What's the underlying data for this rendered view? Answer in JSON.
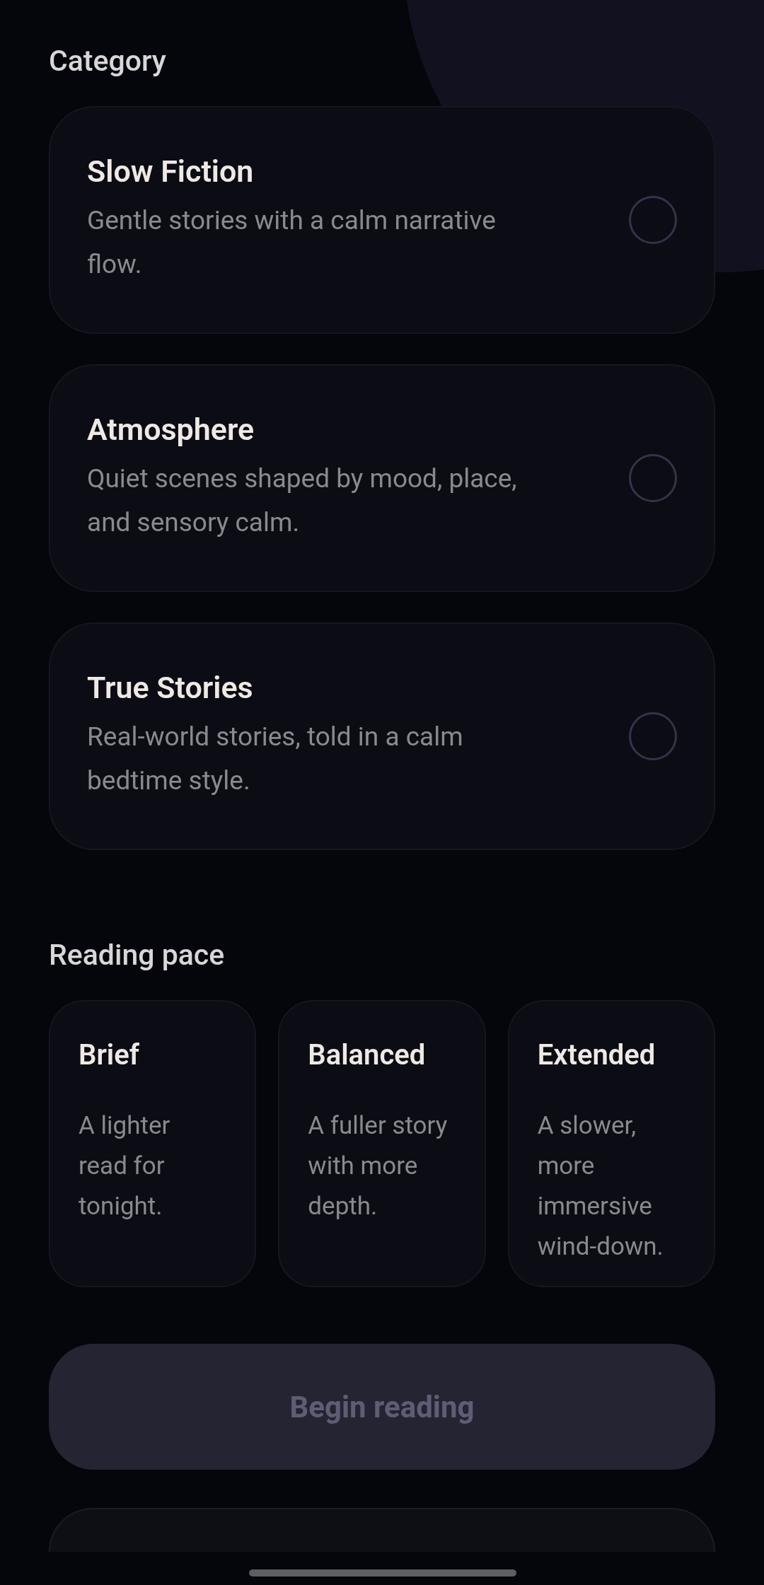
{
  "category": {
    "title": "Category",
    "options": [
      {
        "title": "Slow Fiction",
        "description": "Gentle stories with a calm narrative flow.",
        "selected": false
      },
      {
        "title": "Atmosphere",
        "description": "Quiet scenes shaped by mood, place, and sensory calm.",
        "selected": false
      },
      {
        "title": "True Stories",
        "description": "Real-world stories, told in a calm bedtime style.",
        "selected": false
      }
    ]
  },
  "reading_pace": {
    "title": "Reading pace",
    "options": [
      {
        "title": "Brief",
        "description": "A lighter read for tonight.",
        "selected": false
      },
      {
        "title": "Balanced",
        "description": "A fuller story with more depth.",
        "selected": false
      },
      {
        "title": "Extended",
        "description": "A slower, more immersive wind-down.",
        "selected": false
      }
    ]
  },
  "primary_button": {
    "label": "Begin reading",
    "disabled": true
  }
}
